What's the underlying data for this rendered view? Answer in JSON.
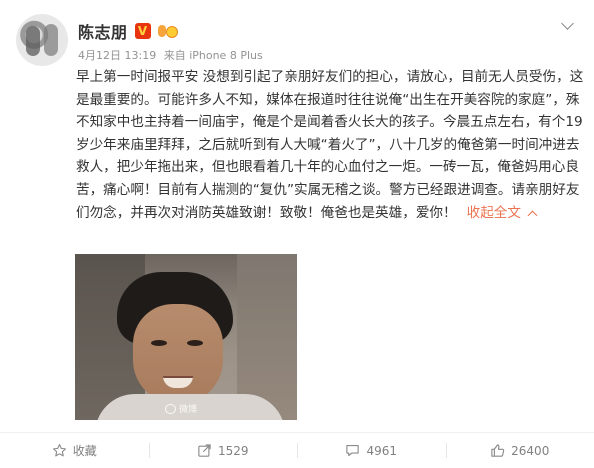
{
  "post": {
    "author": "陈志朋",
    "vip_badge": "V",
    "timestamp": "4月12日 13:19",
    "source": "来自 iPhone 8 Plus",
    "paragraphs": [
      "早上第一时间报平安 没想到引起了亲朋好友们的担心，请放心，目前无人员受伤，这是最重要的。可能许多人不知，媒体在报道时往往说俺“出生在开美容院的家庭”，殊不知家中也主持着一间庙宇，俺是个是闻着香火长大的孩子。今晨五点左右，有个19岁少年来庙里拜拜，之后就听到有人大喊“着火了”，八十几岁的俺爸第一时间冲进去救人，把少年拖出来，但也眼看着几十年的心血付之一炬。一砖一瓦，俺爸妈用心良苦，痛心啊！目前有人揣测的“复仇”实属无稽之谈。警方已经跟进调查。请亲朋好友们勿念，并再次对消防英雄致谢！致敬！俺爸也是英雄，爱你！"
    ],
    "expand_label": "收起全文",
    "image_watermark": "微博"
  },
  "actions": [
    {
      "icon": "star-icon",
      "label": "收藏"
    },
    {
      "icon": "share-icon",
      "label": "1529"
    },
    {
      "icon": "comment-icon",
      "label": "4961"
    },
    {
      "icon": "thumbs-up-icon",
      "label": "26400"
    }
  ],
  "colors": {
    "accent": "#eb7350",
    "vip": "#e8350f",
    "text": "#333333",
    "meta": "#939393"
  }
}
